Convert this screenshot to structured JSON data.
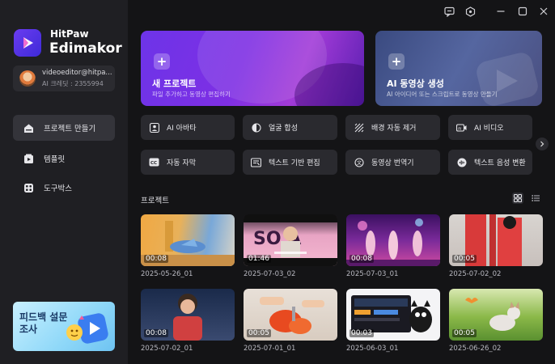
{
  "app": {
    "brand_small": "HitPaw",
    "brand_big": "Edimakor"
  },
  "account": {
    "email": "videoeditor@hitpa...",
    "credits": "AI 크레딧 : 2355994"
  },
  "sidebar": {
    "items": [
      {
        "label": "프로젝트 만들기",
        "icon": "home-icon",
        "active": true
      },
      {
        "label": "템플릿",
        "icon": "template-icon",
        "active": false
      },
      {
        "label": "도구박스",
        "icon": "toolbox-icon",
        "active": false
      }
    ],
    "promo": "피드백 설문조사"
  },
  "hero": {
    "new_project": {
      "title": "새 프로젝트",
      "subtitle": "파일 추가하고 동영상 편집하기"
    },
    "ai_video": {
      "title": "AI 동영상 생성",
      "subtitle": "AI 아이디어 또는 스크립트로 동영상 만들기"
    }
  },
  "features": [
    {
      "label": "AI 아바타",
      "icon": "avatar-icon"
    },
    {
      "label": "얼굴 합성",
      "icon": "face-swap-icon"
    },
    {
      "label": "배경 자동 제거",
      "icon": "background-remove-icon"
    },
    {
      "label": "AI 비디오",
      "icon": "ai-video-icon"
    },
    {
      "label": "자동 자막",
      "icon": "caption-icon"
    },
    {
      "label": "텍스트 기반 편집",
      "icon": "text-edit-icon"
    },
    {
      "label": "동영상 번역기",
      "icon": "translate-icon"
    },
    {
      "label": "텍스트 음성 변환",
      "icon": "tts-icon"
    }
  ],
  "projects_section": {
    "title": "프로젝트"
  },
  "projects": [
    {
      "name": "2025-05-26_01",
      "duration": "00:08"
    },
    {
      "name": "2025-07-03_02",
      "duration": "01:46"
    },
    {
      "name": "2025-07-03_01",
      "duration": "00:08"
    },
    {
      "name": "2025-07-02_02",
      "duration": "00:05"
    },
    {
      "name": "2025-07-02_01",
      "duration": "00:08"
    },
    {
      "name": "2025-07-01_01",
      "duration": "00:05"
    },
    {
      "name": "2025-06-03_01",
      "duration": "00:03"
    },
    {
      "name": "2025-06-26_02",
      "duration": "00:05"
    }
  ]
}
